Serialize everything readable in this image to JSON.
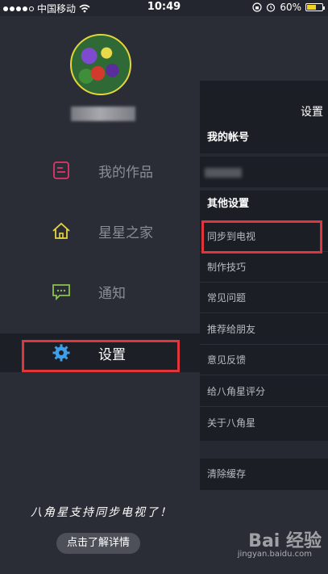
{
  "status_bar": {
    "carrier": "中国移动",
    "time": "10:49",
    "battery_percent": "60%",
    "battery_level": 0.6,
    "icons": [
      "signal-dots-icon",
      "wifi-icon",
      "rotation-lock-icon",
      "alarm-icon",
      "battery-icon"
    ]
  },
  "drawer": {
    "menu": [
      {
        "label": "我的作品",
        "icon": "works-icon",
        "color": "#e0356a"
      },
      {
        "label": "星星之家",
        "icon": "home-icon",
        "color": "#e6d53a"
      },
      {
        "label": "通知",
        "icon": "message-icon",
        "color": "#8bc34a"
      },
      {
        "label": "设置",
        "icon": "gear-icon",
        "color": "#3f9fe8",
        "active": true
      }
    ],
    "promo_text": "八角星支持同步电视了！",
    "detail_button": "点击了解详情"
  },
  "settings": {
    "title": "设置",
    "account_header": "我的帐号",
    "other_header": "其他设置",
    "items": [
      "同步到电视",
      "制作技巧",
      "常见问题",
      "推荐给朋友",
      "意见反馈",
      "给八角星评分",
      "关于八角星"
    ],
    "clear_cache": "清除缓存"
  },
  "watermark": {
    "logo_text": "Bai 经验",
    "url": "jingyan.baidu.com"
  },
  "colors": {
    "background": "#2a2d36",
    "panel": "#1b1e25",
    "highlight": "#e0353b",
    "accent_yellow": "#e6d53a"
  }
}
